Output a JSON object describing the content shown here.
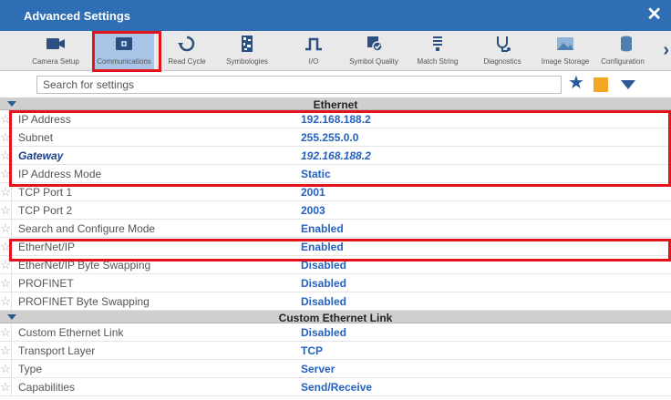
{
  "window": {
    "title": "Advanced Settings",
    "close_glyph": "✕"
  },
  "toolbar": {
    "items": [
      {
        "label": "Camera Setup",
        "icon": "camera-icon"
      },
      {
        "label": "Communications",
        "icon": "communications-icon",
        "active": true
      },
      {
        "label": "Read Cycle",
        "icon": "read-cycle-icon"
      },
      {
        "label": "Symbologies",
        "icon": "symbologies-icon"
      },
      {
        "label": "I/O",
        "icon": "io-pulse-icon"
      },
      {
        "label": "Symbol Quality",
        "icon": "symbol-quality-icon"
      },
      {
        "label": "Match String",
        "icon": "match-string-icon"
      },
      {
        "label": "Diagnostics",
        "icon": "stethoscope-icon"
      },
      {
        "label": "Image Storage",
        "icon": "image-storage-icon"
      },
      {
        "label": "Configuration",
        "icon": "database-icon"
      }
    ],
    "next_glyph": "›"
  },
  "search": {
    "placeholder": "Search for settings",
    "value": ""
  },
  "star_glyph": "☆",
  "sections": [
    {
      "title": "Ethernet",
      "rows": [
        {
          "label": "IP Address",
          "value": "192.168.188.2"
        },
        {
          "label": "Subnet",
          "value": "255.255.0.0"
        },
        {
          "label": "Gateway",
          "value": "192.168.188.2"
        },
        {
          "label": "IP Address Mode",
          "value": "Static"
        },
        {
          "label": "TCP Port 1",
          "value": "2001"
        },
        {
          "label": "TCP Port 2",
          "value": "2003"
        },
        {
          "label": "Search and Configure Mode",
          "value": "Enabled"
        },
        {
          "label": "EtherNet/IP",
          "value": "Enabled"
        },
        {
          "label": "EtherNet/IP Byte Swapping",
          "value": "Disabled"
        },
        {
          "label": "PROFINET",
          "value": "Disabled"
        },
        {
          "label": "PROFINET Byte Swapping",
          "value": "Disabled"
        }
      ]
    },
    {
      "title": "Custom Ethernet Link",
      "rows": [
        {
          "label": "Custom Ethernet Link",
          "value": "Disabled"
        },
        {
          "label": "Transport Layer",
          "value": "TCP"
        },
        {
          "label": "Type",
          "value": "Server"
        },
        {
          "label": "Capabilities",
          "value": "Send/Receive"
        }
      ]
    }
  ],
  "colors": {
    "titlebar": "#2f6db5",
    "value_text": "#2461c2",
    "highlight_box": "#e3131b",
    "favorite_square": "#f5a623"
  }
}
